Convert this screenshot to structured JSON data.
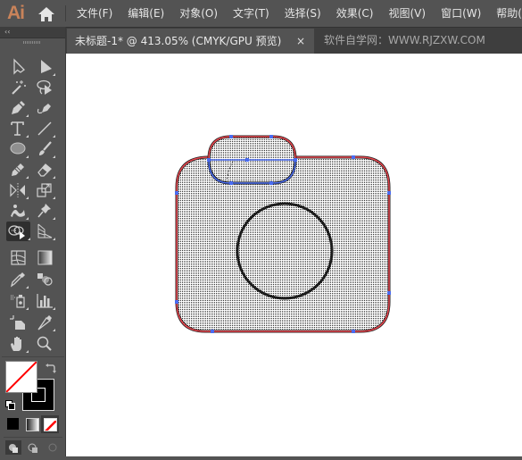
{
  "app": {
    "logo": "Ai",
    "home_icon": "home-icon"
  },
  "menu": {
    "items": [
      {
        "label": "文件(F)"
      },
      {
        "label": "编辑(E)"
      },
      {
        "label": "对象(O)"
      },
      {
        "label": "文字(T)"
      },
      {
        "label": "选择(S)"
      },
      {
        "label": "效果(C)"
      },
      {
        "label": "视图(V)"
      },
      {
        "label": "窗口(W)"
      },
      {
        "label": "帮助(H)"
      }
    ]
  },
  "toolpanel": {
    "collapse_label": "‹‹",
    "tools": [
      {
        "name": "selection-tool"
      },
      {
        "name": "direct-selection-tool"
      },
      {
        "name": "magic-wand-tool"
      },
      {
        "name": "lasso-tool"
      },
      {
        "name": "pen-tool"
      },
      {
        "name": "curvature-tool"
      },
      {
        "name": "type-tool"
      },
      {
        "name": "line-segment-tool"
      },
      {
        "name": "ellipse-tool"
      },
      {
        "name": "paintbrush-tool"
      },
      {
        "name": "pencil-tool"
      },
      {
        "name": "eraser-tool"
      },
      {
        "name": "reflect-tool"
      },
      {
        "name": "scale-tool"
      },
      {
        "name": "puppet-warp-tool"
      },
      {
        "name": "pin-tool"
      },
      {
        "name": "shape-builder-tool",
        "active": true
      },
      {
        "name": "perspective-grid-tool"
      },
      {
        "name": "mesh-tool"
      },
      {
        "name": "gradient-tool"
      },
      {
        "name": "eyedropper-tool"
      },
      {
        "name": "blend-tool"
      },
      {
        "name": "symbol-sprayer-tool"
      },
      {
        "name": "column-graph-tool"
      },
      {
        "name": "artboard-tool"
      },
      {
        "name": "slice-tool"
      },
      {
        "name": "hand-tool"
      },
      {
        "name": "zoom-tool"
      }
    ],
    "fill": "none",
    "stroke": "#000000",
    "colors": {
      "fill_box": "#ffffff",
      "stroke_box": "#000000",
      "none_slash": "#ff0000"
    }
  },
  "document": {
    "tab_title": "未标题-1* @ 413.05% (CMYK/GPU 预览)",
    "close_label": "×",
    "zoom": "413.05%",
    "color_mode": "CMYK/GPU 预览",
    "watermark": "软件自学网：WWW.RJZXW.COM"
  },
  "artwork": {
    "description": "camera icon",
    "selection_color": "#e8454d",
    "anchor_color": "#4a6cf0",
    "path_color": "#1c1c1c"
  }
}
